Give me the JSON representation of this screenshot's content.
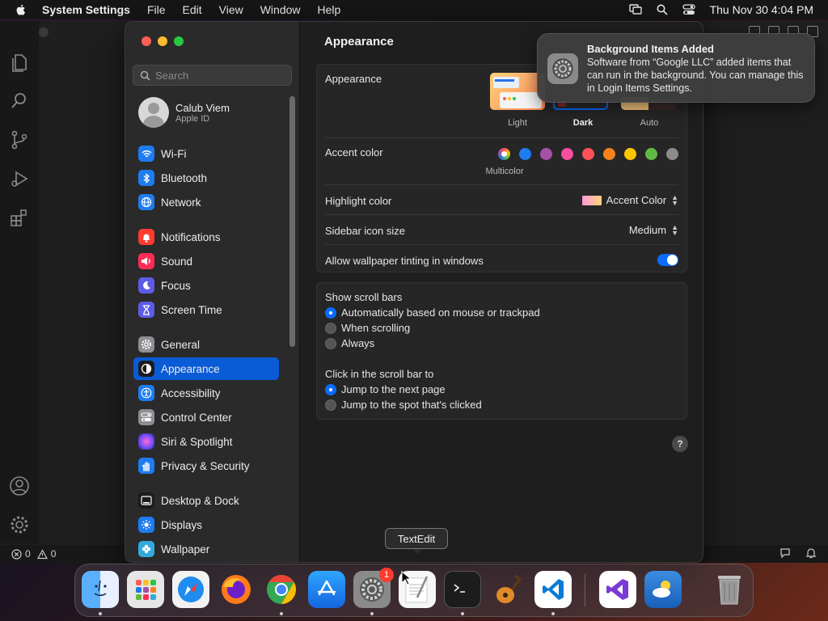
{
  "menubar": {
    "app_name": "System Settings",
    "items": [
      "File",
      "Edit",
      "View",
      "Window",
      "Help"
    ],
    "clock": "Thu Nov 30  4:04 PM"
  },
  "vscode": {
    "status_errors": "0",
    "status_warnings": "0"
  },
  "sidebar": {
    "search_placeholder": "Search",
    "profile": {
      "name": "Calub Viem",
      "subtitle": "Apple ID"
    },
    "items": [
      {
        "label": "Wi-Fi",
        "color": "#1e7cf0"
      },
      {
        "label": "Bluetooth",
        "color": "#1e7cf0"
      },
      {
        "label": "Network",
        "color": "#1e7cf0"
      },
      {
        "label": "Notifications",
        "color": "#ff3b30"
      },
      {
        "label": "Sound",
        "color": "#ff2d55"
      },
      {
        "label": "Focus",
        "color": "#5e5ce6"
      },
      {
        "label": "Screen Time",
        "color": "#5e5ce6"
      },
      {
        "label": "General",
        "color": "#8e8e93"
      },
      {
        "label": "Appearance",
        "color": "#1c1c1e"
      },
      {
        "label": "Accessibility",
        "color": "#1e7cf0"
      },
      {
        "label": "Control Center",
        "color": "#8e8e93"
      },
      {
        "label": "Siri & Spotlight",
        "color": "#bf5af2"
      },
      {
        "label": "Privacy & Security",
        "color": "#1e7cf0"
      },
      {
        "label": "Desktop & Dock",
        "color": "#1c1c1e"
      },
      {
        "label": "Displays",
        "color": "#1e7cf0"
      },
      {
        "label": "Wallpaper",
        "color": "#34aadc"
      }
    ],
    "selected": "Appearance"
  },
  "main": {
    "title": "Appearance",
    "appearance": {
      "label": "Appearance",
      "options": [
        "Light",
        "Dark",
        "Auto"
      ],
      "selected": "Dark"
    },
    "accent": {
      "label": "Accent color",
      "selected_name": "Multicolor",
      "colors": [
        "#b06ad8",
        "#1e7cf0",
        "#a550a7",
        "#f74f9e",
        "#ff5257",
        "#f7821b",
        "#ffc600",
        "#62ba46",
        "#8c8c8c"
      ]
    },
    "highlight": {
      "label": "Highlight color",
      "value": "Accent Color"
    },
    "sidebar_icon_size": {
      "label": "Sidebar icon size",
      "value": "Medium"
    },
    "wallpaper_tinting": {
      "label": "Allow wallpaper tinting in windows",
      "on": true
    },
    "scroll_bars": {
      "label": "Show scroll bars",
      "options": [
        "Automatically based on mouse or trackpad",
        "When scrolling",
        "Always"
      ],
      "selected": 0
    },
    "click_scroll": {
      "label": "Click in the scroll bar to",
      "options": [
        "Jump to the next page",
        "Jump to the spot that's clicked"
      ],
      "selected": 0
    },
    "help": "?"
  },
  "notification": {
    "title": "Background Items Added",
    "body": "Software from “Google LLC” added items that can run in the background. You can manage this in Login Items Settings."
  },
  "tooltip": "TextEdit",
  "dock": {
    "badge": "1",
    "apps": [
      "finder",
      "launchpad",
      "safari",
      "firefox",
      "chrome",
      "app-store",
      "system-settings",
      "textedit",
      "terminal",
      "garageband",
      "vscode",
      "visual-studio",
      "weather",
      "trash"
    ]
  }
}
